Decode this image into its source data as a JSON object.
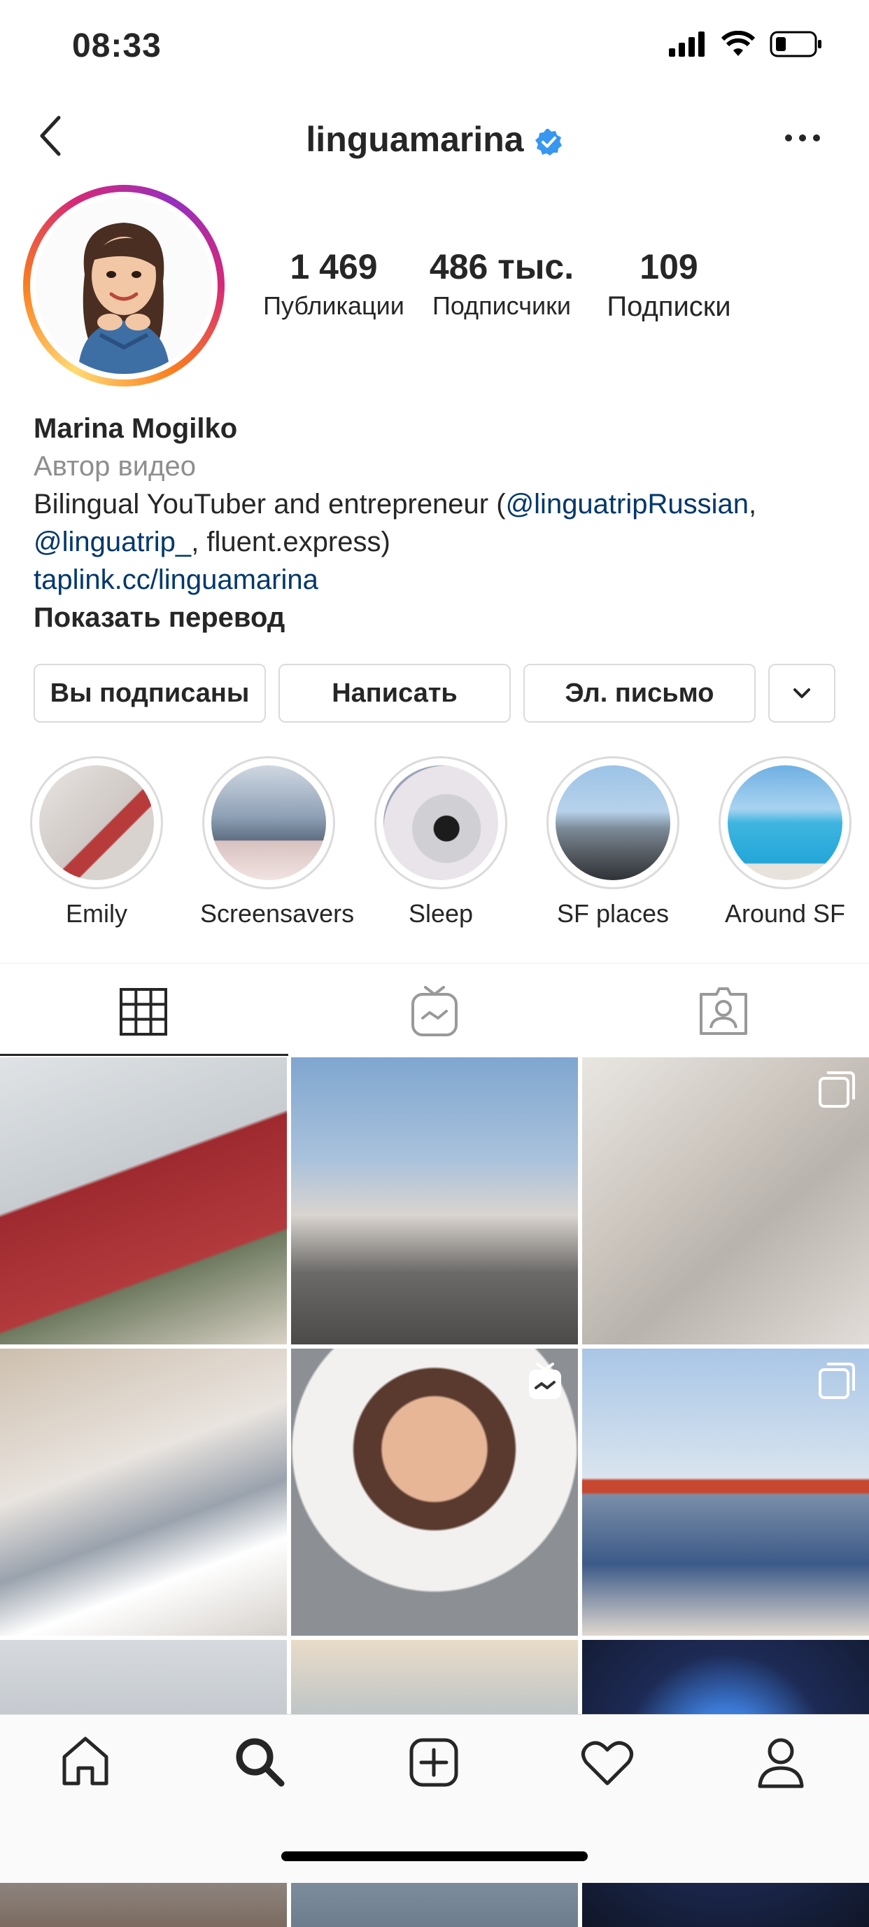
{
  "status_bar": {
    "time": "08:33"
  },
  "header": {
    "username": "linguamarina"
  },
  "profile": {
    "stats": [
      {
        "value": "1 469",
        "label": "Публикации"
      },
      {
        "value": "486 тыс.",
        "label": "Подписчики"
      },
      {
        "value": "109",
        "label": "Подписки"
      }
    ],
    "name": "Marina Mogilko",
    "category": "Автор видео",
    "bio_prefix": "Bilingual YouTuber and entrepreneur (",
    "mention1": "@linguatripRussian",
    "bio_comma": ",",
    "mention2": "@linguatrip_",
    "bio_suffix": ", fluent.express)",
    "website": "taplink.cc/linguamarina",
    "translate": "Показать перевод"
  },
  "buttons": {
    "following": "Вы подписаны",
    "message": "Написать",
    "email": "Эл. письмо"
  },
  "highlights": [
    "Emily",
    "Screensavers",
    "Sleep",
    "SF places",
    "Around SF"
  ],
  "colors": {
    "link": "#00376b",
    "verified": "#3897f0",
    "secondary": "#8e8e8e"
  }
}
